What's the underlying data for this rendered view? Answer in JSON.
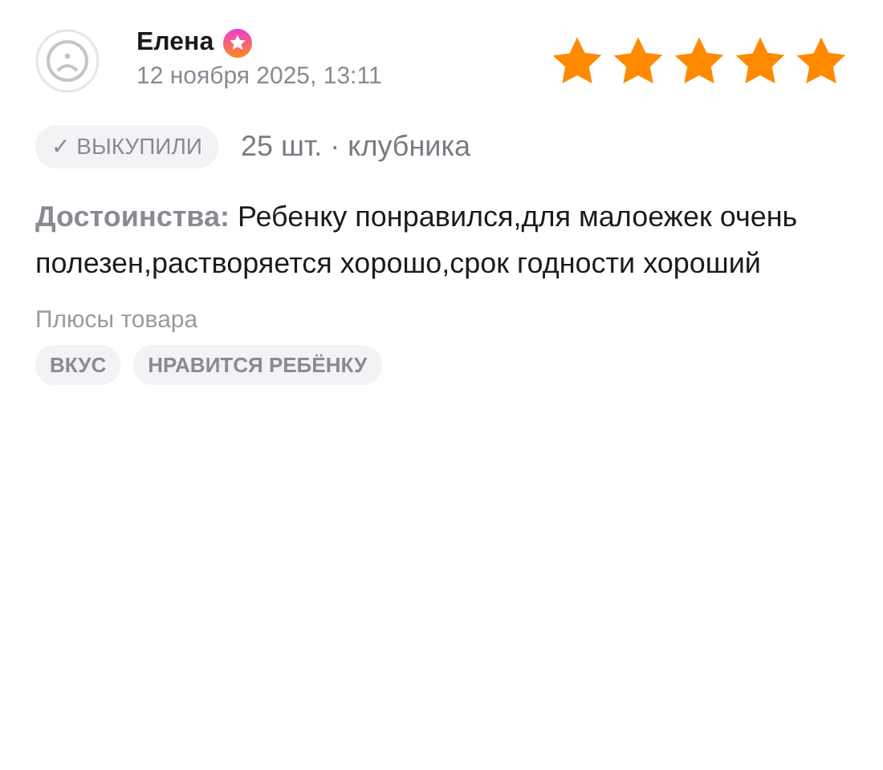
{
  "review": {
    "author": "Елена",
    "date": "12 ноября 2025, 13:11",
    "stars": 5,
    "purchase_badge": {
      "check": "✓",
      "label": "ВЫКУПИЛИ"
    },
    "variant": "25 шт. · клубника",
    "pros_label": "Достоинства:",
    "pros_text": "Ребенку понравился,для малоежек очень полезен,растворяется хорошо,срок годности хороший",
    "tags_title": "Плюсы товара",
    "tags": [
      "ВКУС",
      "НРАВИТСЯ РЕБЁНКУ"
    ]
  }
}
